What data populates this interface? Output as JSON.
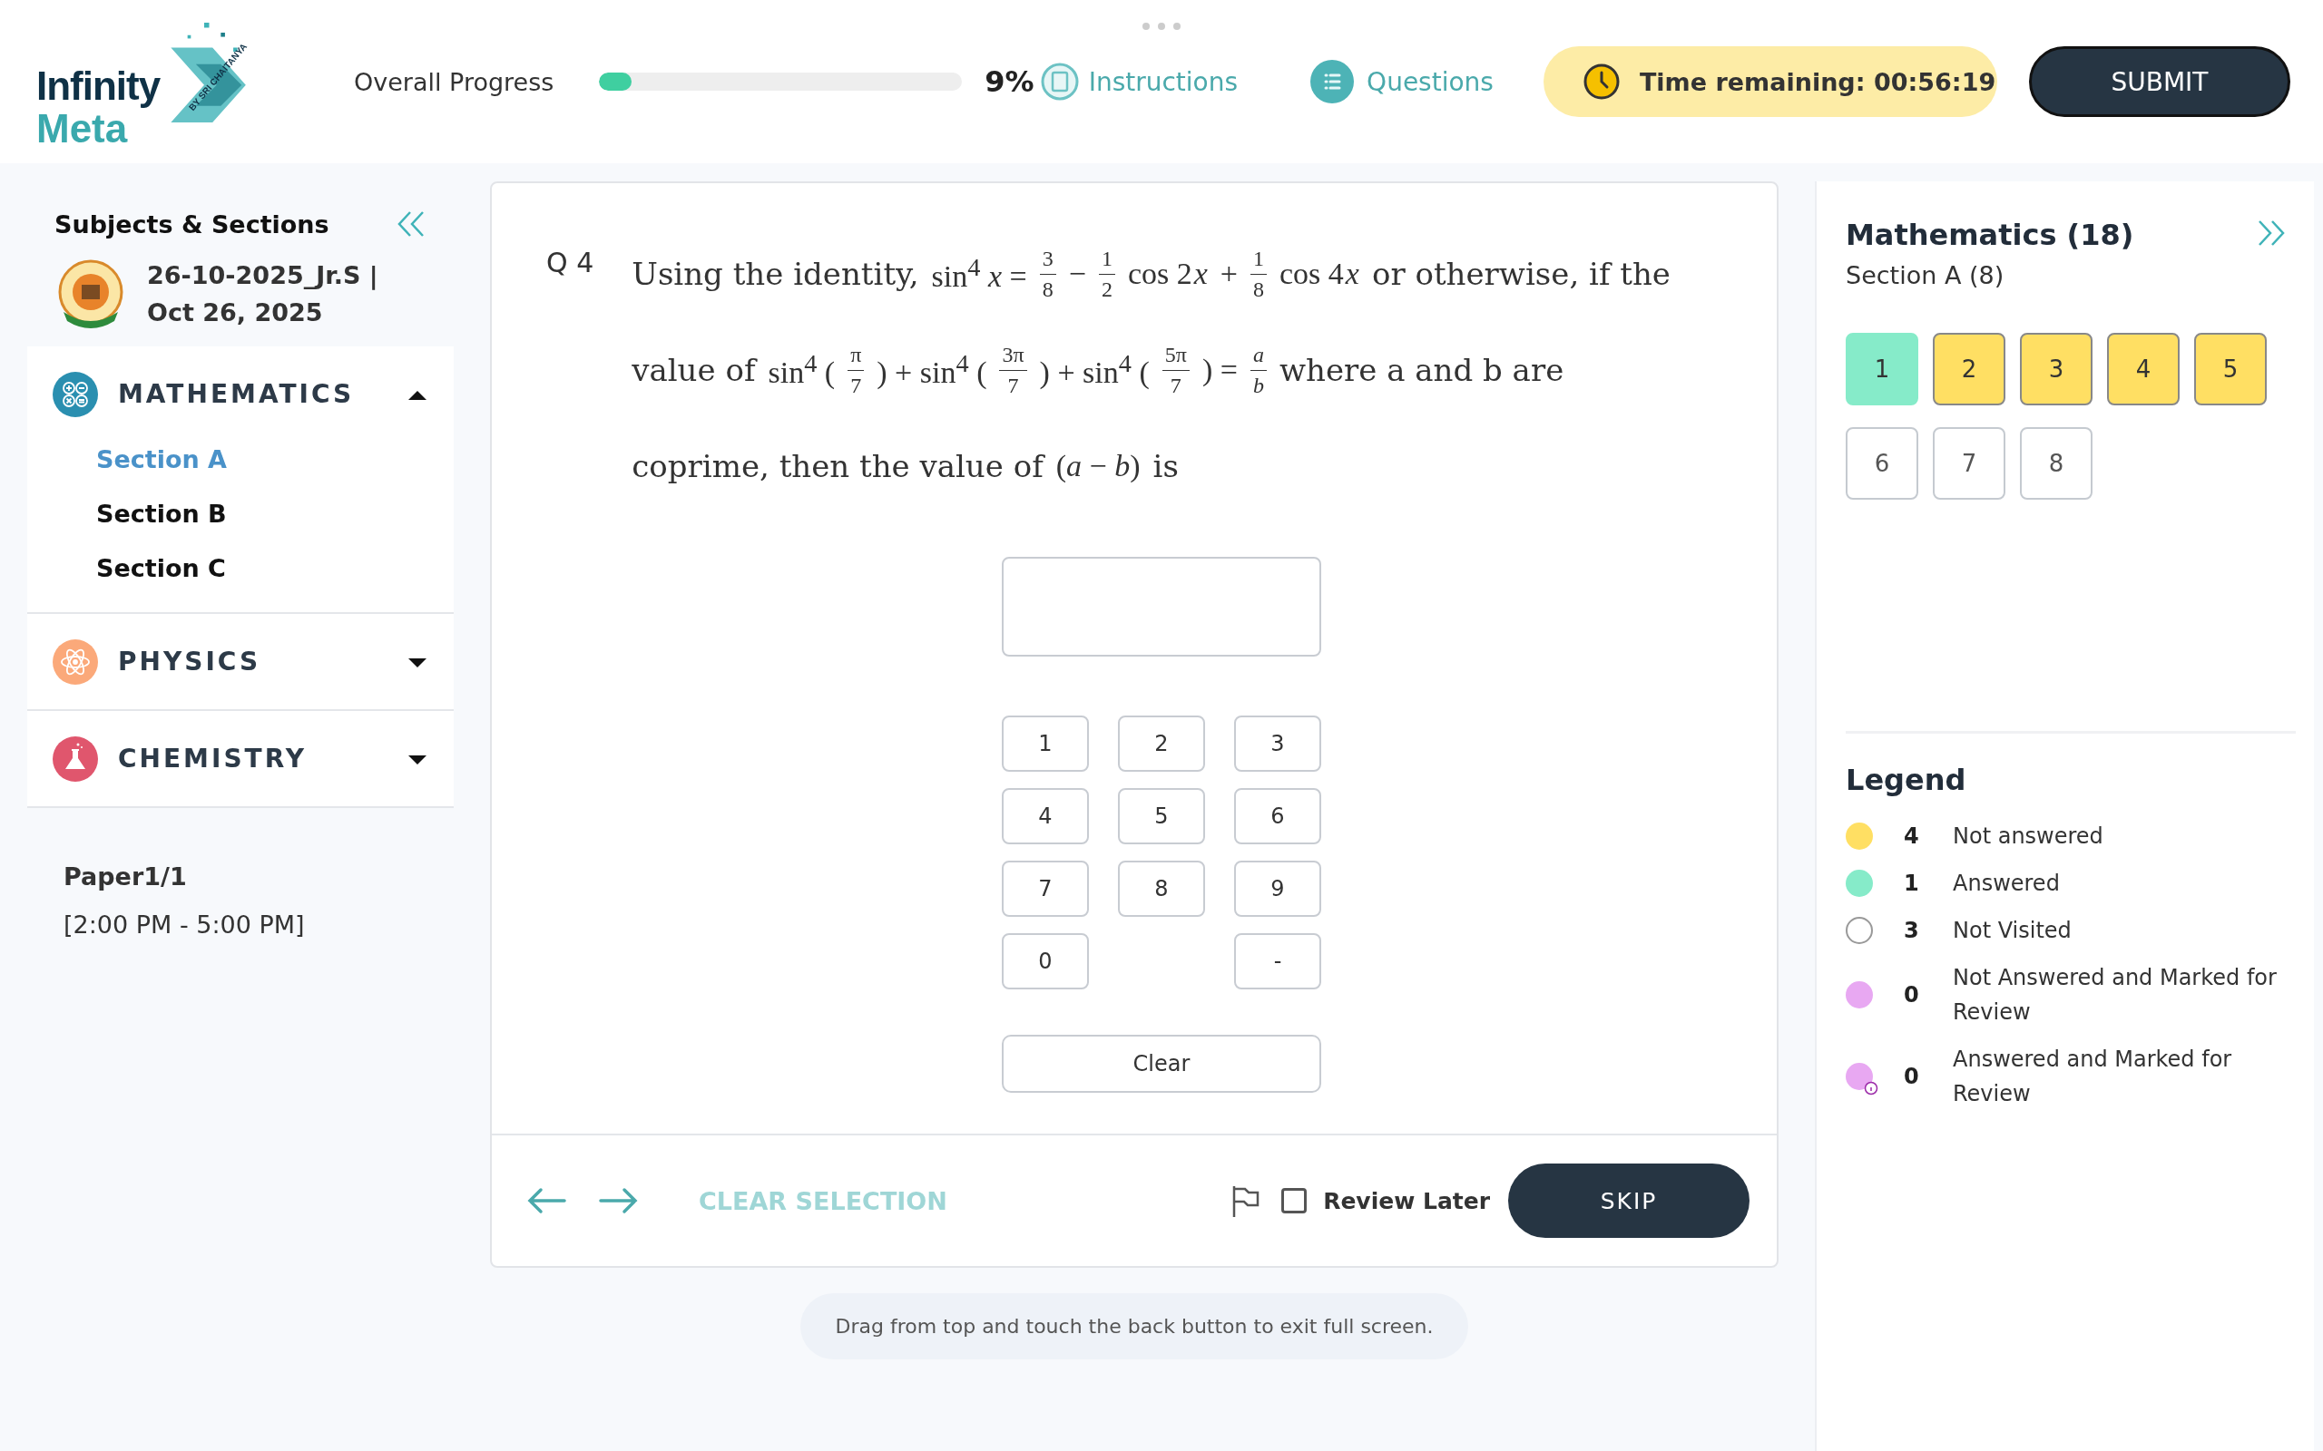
{
  "header": {
    "logo": {
      "line1": "Infinity",
      "line2": "Meta",
      "tagline": "BY SRI CHAITANYA"
    },
    "progress": {
      "label": "Overall Progress",
      "level": 0.09,
      "percent": "9%"
    },
    "links": [
      {
        "label": "Instructions",
        "kind": "instructions"
      },
      {
        "label": "Questions",
        "kind": "questions"
      }
    ],
    "timer": "Time remaining: 00:56:19",
    "submit": "SUBMIT"
  },
  "sidebar": {
    "title": "Subjects & Sections",
    "exam": {
      "name": "26-10-2025_Jr.S |",
      "date": "Oct 26, 2025"
    },
    "subjects": [
      {
        "name": "MATHEMATICS",
        "kind": "math",
        "expanded": true,
        "sections": [
          {
            "label": "Section A",
            "selected": true
          },
          {
            "label": "Section B",
            "selected": false
          },
          {
            "label": "Section C",
            "selected": false
          }
        ]
      },
      {
        "name": "PHYSICS",
        "kind": "physics",
        "expanded": false
      },
      {
        "name": "CHEMISTRY",
        "kind": "chemistry",
        "expanded": false
      }
    ],
    "paper": {
      "name": "Paper1/1",
      "time": "[2:00 PM - 5:00 PM]"
    }
  },
  "question": {
    "number": "Q 4",
    "lines": [
      [
        {
          "kind": "text",
          "text": "Using the identity,"
        },
        {
          "kind": "math",
          "text": "sin$^{4}$ *x* ="
        },
        {
          "kind": "frac",
          "num": "3",
          "den": "8"
        },
        {
          "kind": "math",
          "text": "−"
        },
        {
          "kind": "frac",
          "num": "1",
          "den": "2"
        },
        {
          "kind": "math",
          "text": "cos 2"
        },
        {
          "kind": "var",
          "text": "x"
        },
        {
          "kind": "math",
          "text": "+"
        },
        {
          "kind": "frac",
          "num": "1",
          "den": "8"
        },
        {
          "kind": "math",
          "text": "cos 4"
        },
        {
          "kind": "var",
          "text": "x"
        },
        {
          "kind": "text",
          "text": "or otherwise, if the"
        }
      ],
      [
        {
          "kind": "text",
          "text": "value of"
        },
        {
          "kind": "math",
          "text": "sin$^{4}$ ("
        },
        {
          "kind": "frac",
          "num": "π",
          "den": "7"
        },
        {
          "kind": "math",
          "text": ") + sin$^{4}$ ("
        },
        {
          "kind": "frac",
          "num": "3π",
          "den": "7"
        },
        {
          "kind": "math",
          "text": ") + sin$^{4}$ ("
        },
        {
          "kind": "frac",
          "num": "5π",
          "den": "7"
        },
        {
          "kind": "math",
          "text": ") ="
        },
        {
          "kind": "frac",
          "num": "*a*",
          "den": "*b*"
        },
        {
          "kind": "text",
          "text": "where a and b are"
        }
      ],
      [
        {
          "kind": "text",
          "text": "coprime, then the value of"
        },
        {
          "kind": "math",
          "text": "(*a* − *b*)"
        },
        {
          "kind": "text",
          "text": "is"
        }
      ]
    ],
    "keypad": [
      [
        {
          "kind": "key",
          "label": "1"
        },
        {
          "kind": "key",
          "label": "2"
        },
        {
          "kind": "key",
          "label": "3"
        }
      ],
      [
        {
          "kind": "key",
          "label": "4"
        },
        {
          "kind": "key",
          "label": "5"
        },
        {
          "kind": "key",
          "label": "6"
        }
      ],
      [
        {
          "kind": "key",
          "label": "7"
        },
        {
          "kind": "key",
          "label": "8"
        },
        {
          "kind": "key",
          "label": "9"
        }
      ],
      [
        {
          "kind": "key",
          "label": "0"
        },
        {
          "kind": "gap"
        },
        {
          "kind": "key",
          "label": "-"
        }
      ]
    ],
    "clear": "Clear"
  },
  "footer": {
    "clear_selection": "CLEAR SELECTION",
    "review_later": {
      "label": "Review Later",
      "checked": false
    },
    "skip": "SKIP"
  },
  "toast": "Drag from top and touch the back button to exit full screen.",
  "palette": {
    "title": "Mathematics (18)",
    "section": "Section A (8)",
    "questions": [
      {
        "label": "1",
        "answered": true,
        "visited": true
      },
      {
        "label": "2",
        "answered": false,
        "visited": true
      },
      {
        "label": "3",
        "answered": false,
        "visited": true
      },
      {
        "label": "4",
        "answered": false,
        "visited": true
      },
      {
        "label": "5",
        "answered": false,
        "visited": true
      },
      {
        "label": "6",
        "answered": false,
        "visited": false
      },
      {
        "label": "7",
        "answered": false,
        "visited": false
      },
      {
        "label": "8",
        "answered": false,
        "visited": false
      }
    ]
  },
  "legend": {
    "title": "Legend",
    "items": [
      {
        "color": "#ffdf63",
        "count": "4",
        "label": "Not answered",
        "kind": "plain"
      },
      {
        "color": "#86ebc9",
        "count": "1",
        "label": "Answered",
        "kind": "plain"
      },
      {
        "color": "#ffffff",
        "count": "3",
        "label": "Not Visited",
        "kind": "plain"
      },
      {
        "color": "#e8a8f2",
        "count": "0",
        "label": "Not Answered and Marked for Review",
        "kind": "plain"
      },
      {
        "color": "#e8a8f2",
        "count": "0",
        "label": "Answered and Marked for Review",
        "kind": "answered"
      }
    ]
  }
}
